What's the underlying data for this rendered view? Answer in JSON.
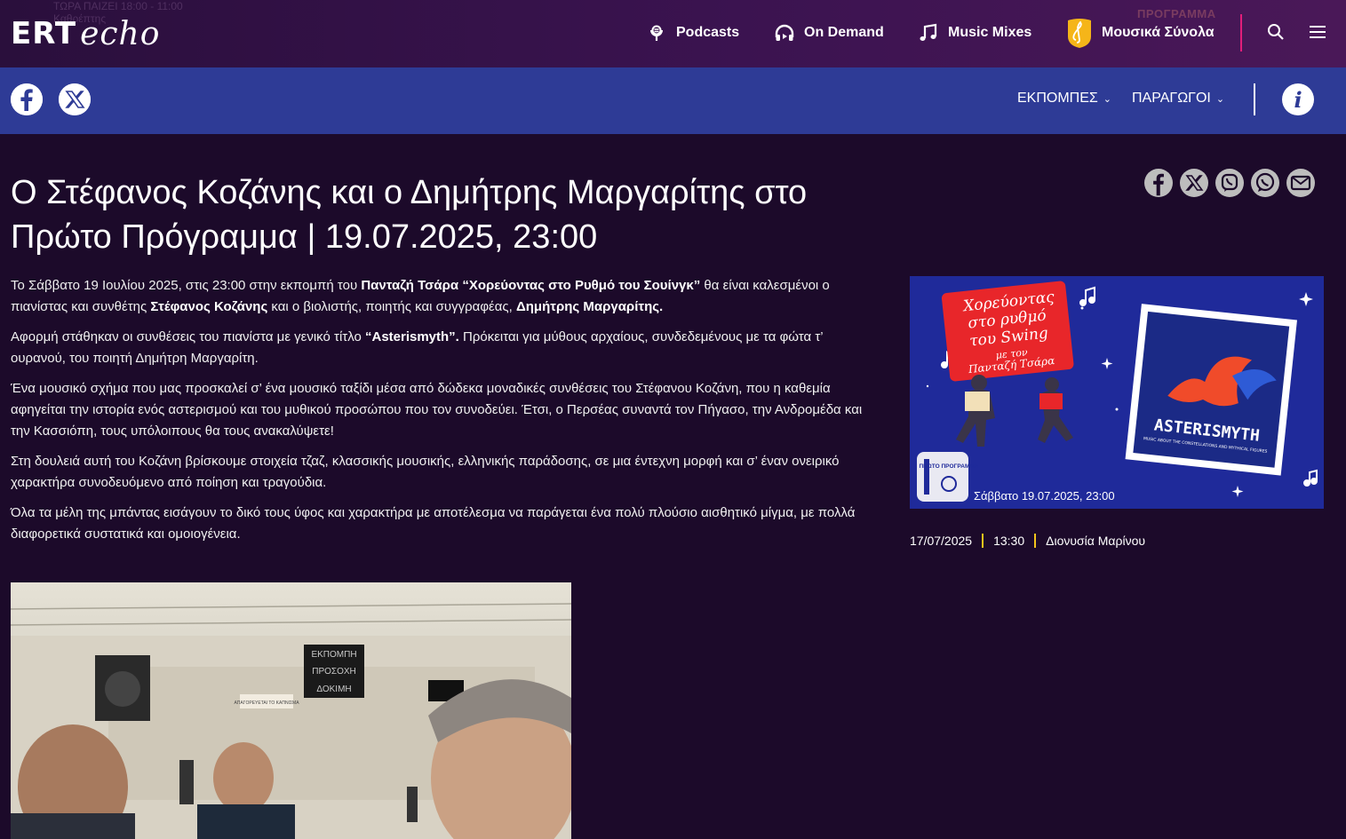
{
  "header": {
    "logo_ert": "ERT",
    "logo_echo": "echo",
    "now_playing_line1": "ΤΩΡΑ ΠΑΙΖΕΙ 18:00 - 11:00",
    "now_playing_line2": "Καθρέπτης",
    "nav": [
      {
        "label": "Podcasts",
        "icon": "podcast-icon"
      },
      {
        "label": "On Demand",
        "icon": "headphones-icon"
      },
      {
        "label": "Music Mixes",
        "icon": "music-note-icon"
      },
      {
        "label": "Μουσικά Σύνολα",
        "icon": "ensembles-icon"
      }
    ],
    "program_ghost": "ΠΡΟΓΡΑΜΜΑ"
  },
  "subnav": {
    "items": [
      {
        "label": "ΕΚΠΟΜΠΕΣ"
      },
      {
        "label": "ΠΑΡΑΓΩΓΟΙ"
      }
    ]
  },
  "article": {
    "title": "Ο Στέφανος Κοζάνης και ο Δημήτρης Μαργαρίτης στο Πρώτο Πρόγραμμα | 19.07.2025, 23:00",
    "p1_a": "Το Σάββατο 19 Ιουλίου 2025, στις 23:00 στην εκπομπή του ",
    "p1_b": "Πανταζή Τσάρα  “Χορεύοντας στο Ρυθμό του Σουίνγκ”",
    "p1_c": " θα είναι καλεσμένοι ο πιανίστας και συνθέτης ",
    "p1_d": "Στέφανος Κοζάνης",
    "p1_e": " και ο βιολιστής, ποιητής και συγγραφέας, ",
    "p1_f": "Δημήτρης  Μαργαρίτης.",
    "p2_a": "Αφορμή στάθηκαν οι συνθέσεις του πιανίστα με γενικό τίτλο ",
    "p2_b": "“Asterismyth”.",
    "p2_c": " Πρόκειται για μύθους αρχαίους, συνδεδεμένους με τα φώτα τ’ ουρανού, του ποιητή Δημήτρη Μαργαρίτη.",
    "p3": "Ένα  μουσικό σχήμα που μας προσκαλεί σ’ ένα μουσικό ταξίδι μέσα από δώδεκα μοναδικές συνθέσεις του Στέφανου Κοζάνη, που η καθεμία  αφηγείται την ιστορία ενός αστερισμού και του μυθικού προσώπου που τον συνοδεύει. Έτσι, ο Περσέας συναντά τον Πήγασο, την Ανδρομέδα και την Κασσιόπη, τους υπόλοιπους θα τους ανακαλύψετε!",
    "p4": "Στη δουλειά αυτή του Κοζάνη βρίσκουμε στοιχεία τζαζ, κλασσικής μουσικής, ελληνικής παράδοσης, σε μια έντεχνη μορφή και σ’ έναν ονειρικό χαρακτήρα συνοδευόμενο από ποίηση και τραγούδια.",
    "p5": "Όλα τα μέλη της μπάντας εισάγουν το δικό τους ύφος και χαρακτήρα με αποτέλεσμα να παράγεται ένα πολύ πλούσιο αισθητικό μίγμα, με πολλά διαφορετικά συστατικά και ομοιογένεια."
  },
  "promo": {
    "show_title_line1": "Χορεύοντας",
    "show_title_line2": "στο ρυθμό",
    "show_title_line3": "του Swing",
    "host_line1": "με τον",
    "host_line2": "Πανταζή Τσάρα",
    "album_title": "ASTERISMYTH",
    "album_subtitle": "MUSIC ABOUT THE CONSTELLATIONS AND MYTHICAL FIGURES",
    "station_label": "ΠΡΩΤΟ ΠΡΟΓΡΑΜΜΑ",
    "date_line": "Σάββατο 19.07.2025, 23:00"
  },
  "meta": {
    "date": "17/07/2025",
    "time": "13:30",
    "author": "Διονυσία Μαρίνου"
  },
  "photo_signs": {
    "sign1": "ΕΚΠΟΜΠΗ",
    "sign2": "ΠΡΟΣΟΧΗ",
    "sign3": "ΔΟΚΙΜΗ",
    "notice": "ΑΠΑΓΟΡΕΥΕΤΑΙ ΤΟ ΚΑΠΝΙΣΜΑ"
  },
  "colors": {
    "topbar": "#3b1350",
    "subnav": "#2e3b96",
    "page_bg": "#1c0a2a",
    "accent_pink": "#e21e7a",
    "meta_separator": "#f3c41c"
  }
}
